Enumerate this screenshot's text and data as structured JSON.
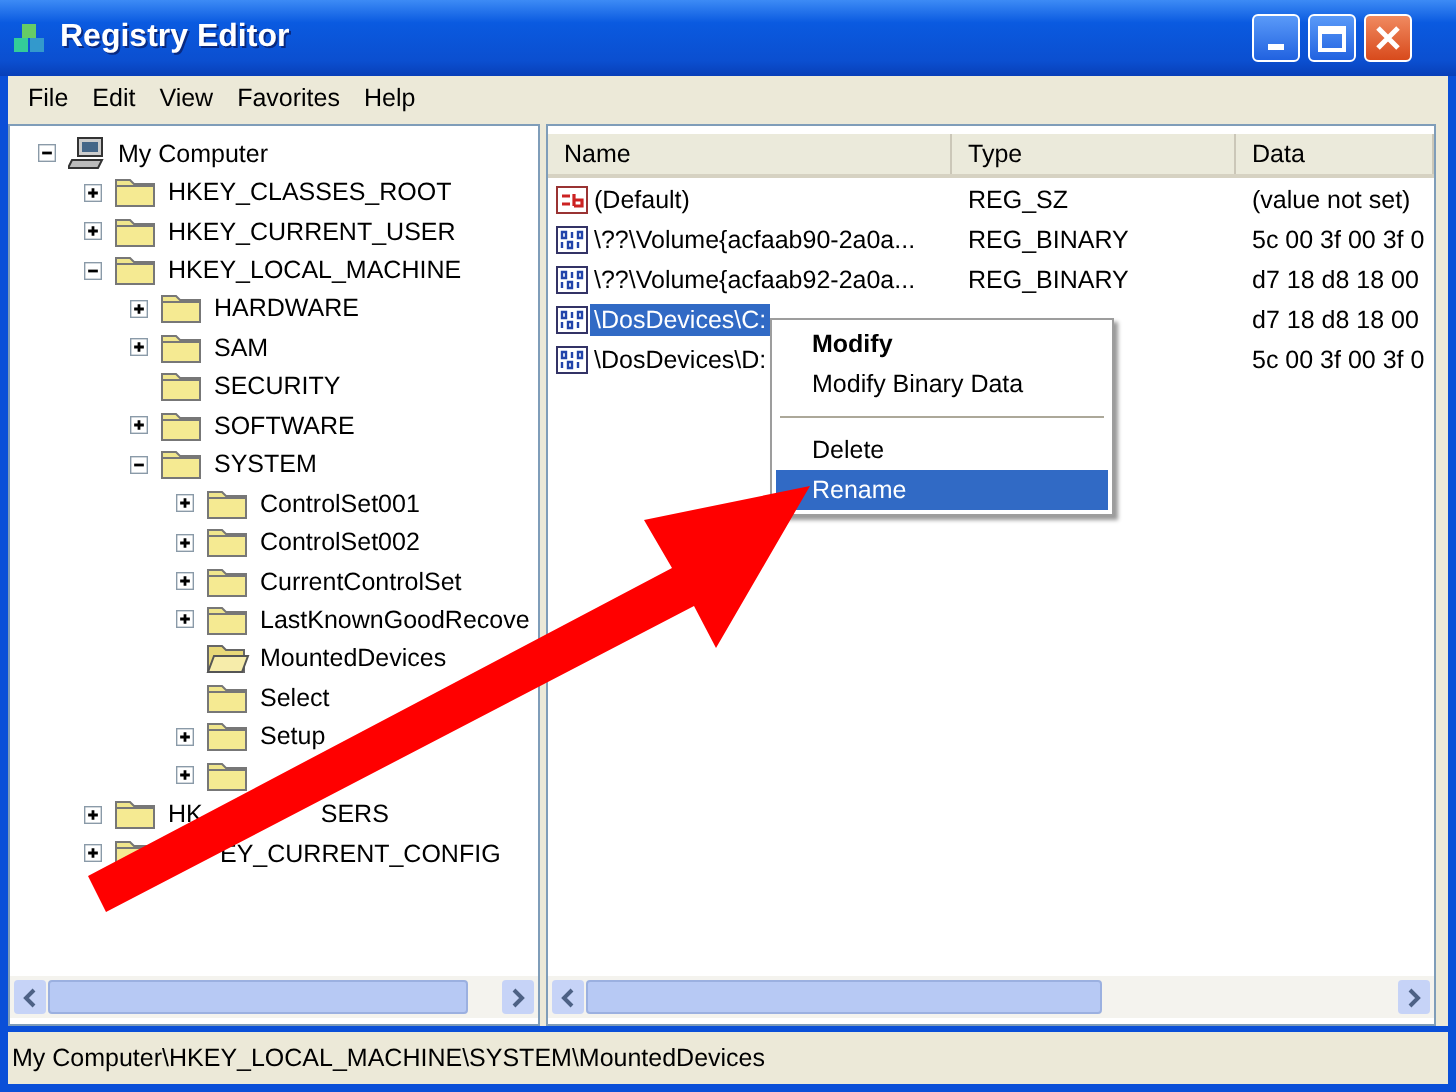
{
  "window": {
    "title": "Registry Editor"
  },
  "menu": [
    "File",
    "Edit",
    "View",
    "Favorites",
    "Help"
  ],
  "tree": [
    {
      "label": "My Computer",
      "kind": "computer",
      "expanded": true,
      "selected": false,
      "children": [
        {
          "label": "HKEY_CLASSES_ROOT",
          "kind": "folder",
          "expanded": false,
          "selected": false
        },
        {
          "label": "HKEY_CURRENT_USER",
          "kind": "folder",
          "expanded": false,
          "selected": false
        },
        {
          "label": "HKEY_LOCAL_MACHINE",
          "kind": "folder",
          "expanded": true,
          "selected": false,
          "children": [
            {
              "label": "HARDWARE",
              "kind": "folder",
              "expanded": false,
              "selected": false
            },
            {
              "label": "SAM",
              "kind": "folder",
              "expanded": false,
              "selected": false
            },
            {
              "label": "SECURITY",
              "kind": "folder",
              "selected": false
            },
            {
              "label": "SOFTWARE",
              "kind": "folder",
              "expanded": false,
              "selected": false
            },
            {
              "label": "SYSTEM",
              "kind": "folder",
              "expanded": true,
              "selected": false,
              "children": [
                {
                  "label": "ControlSet001",
                  "kind": "folder",
                  "expanded": false,
                  "selected": false
                },
                {
                  "label": "ControlSet002",
                  "kind": "folder",
                  "expanded": false,
                  "selected": false
                },
                {
                  "label": "CurrentControlSet",
                  "kind": "folder",
                  "expanded": false,
                  "selected": false
                },
                {
                  "label": "LastKnownGoodRecove",
                  "kind": "folder",
                  "expanded": false,
                  "selected": false
                },
                {
                  "label": "MountedDevices",
                  "kind": "folder",
                  "selected": true
                },
                {
                  "label": "Select",
                  "kind": "folder",
                  "selected": false
                },
                {
                  "label": "Setup",
                  "kind": "folder",
                  "expanded": false,
                  "selected": false
                },
                {
                  "kind": "folder",
                  "expanded": false,
                  "selected": false
                }
              ]
            }
          ]
        },
        {
          "label": "HK",
          "label_after_arrow": "SERS",
          "kind": "folder",
          "expanded": false,
          "selected": false
        },
        {
          "label": "EY_CURRENT_CONFIG",
          "start_under_arrow": true,
          "kind": "folder",
          "expanded": false,
          "selected": false
        }
      ]
    }
  ],
  "table": {
    "columns": [
      "Name",
      "Type",
      "Data"
    ],
    "rows": [
      {
        "kind": "string",
        "name": "(Default)",
        "type": "REG_SZ",
        "data": "(value not set)",
        "selected": false
      },
      {
        "kind": "binary",
        "name": "\\??\\Volume{acfaab90-2a0a...",
        "type": "REG_BINARY",
        "data": "5c 00 3f 00 3f 0",
        "selected": false
      },
      {
        "kind": "binary",
        "name": "\\??\\Volume{acfaab92-2a0a...",
        "type": "REG_BINARY",
        "data": "d7 18 d8 18 00",
        "selected": false
      },
      {
        "kind": "binary",
        "name": "\\DosDevices\\C:",
        "data": "d7 18 d8 18 00",
        "selected": true
      },
      {
        "kind": "binary",
        "name": "\\DosDevices\\D:",
        "data": "5c 00 3f 00 3f 0",
        "selected": false
      }
    ]
  },
  "context_menu": [
    {
      "kind": "item",
      "label": "Modify",
      "default": true,
      "selected": false
    },
    {
      "kind": "item",
      "label": "Modify Binary Data",
      "default": false,
      "selected": false
    },
    {
      "kind": "separator"
    },
    {
      "kind": "item",
      "label": "Delete",
      "default": false,
      "selected": false
    },
    {
      "kind": "item",
      "label": "Rename",
      "default": false,
      "selected": true
    }
  ],
  "status_bar": "My Computer\\HKEY_LOCAL_MACHINE\\SYSTEM\\MountedDevices"
}
